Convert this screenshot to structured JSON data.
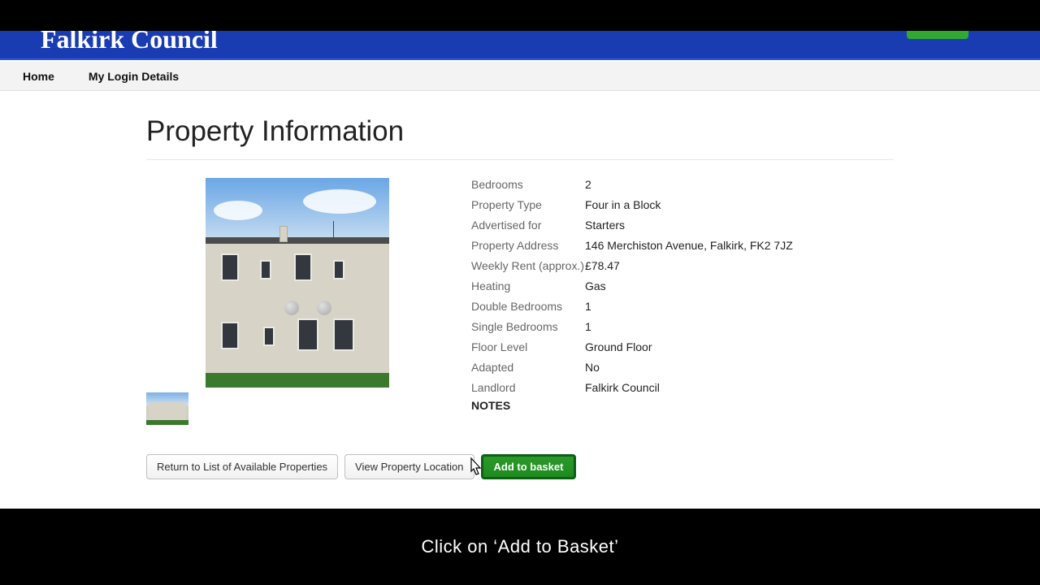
{
  "brand": "Falkirk Council",
  "nav": {
    "home": "Home",
    "login": "My Login Details"
  },
  "page": {
    "title": "Property Information"
  },
  "details": {
    "bedrooms_label": "Bedrooms",
    "bedrooms_value": "2",
    "type_label": "Property Type",
    "type_value": "Four in a Block",
    "advertised_label": "Advertised for",
    "advertised_value": "Starters",
    "address_label": "Property Address",
    "address_value": "146 Merchiston Avenue, Falkirk, FK2 7JZ",
    "rent_label": "Weekly Rent (approx.)",
    "rent_value": "£78.47",
    "heating_label": "Heating",
    "heating_value": "Gas",
    "dbl_label": "Double Bedrooms",
    "dbl_value": "1",
    "sgl_label": "Single Bedrooms",
    "sgl_value": "1",
    "floor_label": "Floor Level",
    "floor_value": "Ground Floor",
    "adapted_label": "Adapted",
    "adapted_value": "No",
    "landlord_label": "Landlord",
    "landlord_value": "Falkirk Council",
    "notes_label": "NOTES"
  },
  "buttons": {
    "return": "Return to List of Available Properties",
    "view_location": "View Property Location",
    "add_basket": "Add to basket"
  },
  "caption": "Click on ‘Add to Basket’"
}
